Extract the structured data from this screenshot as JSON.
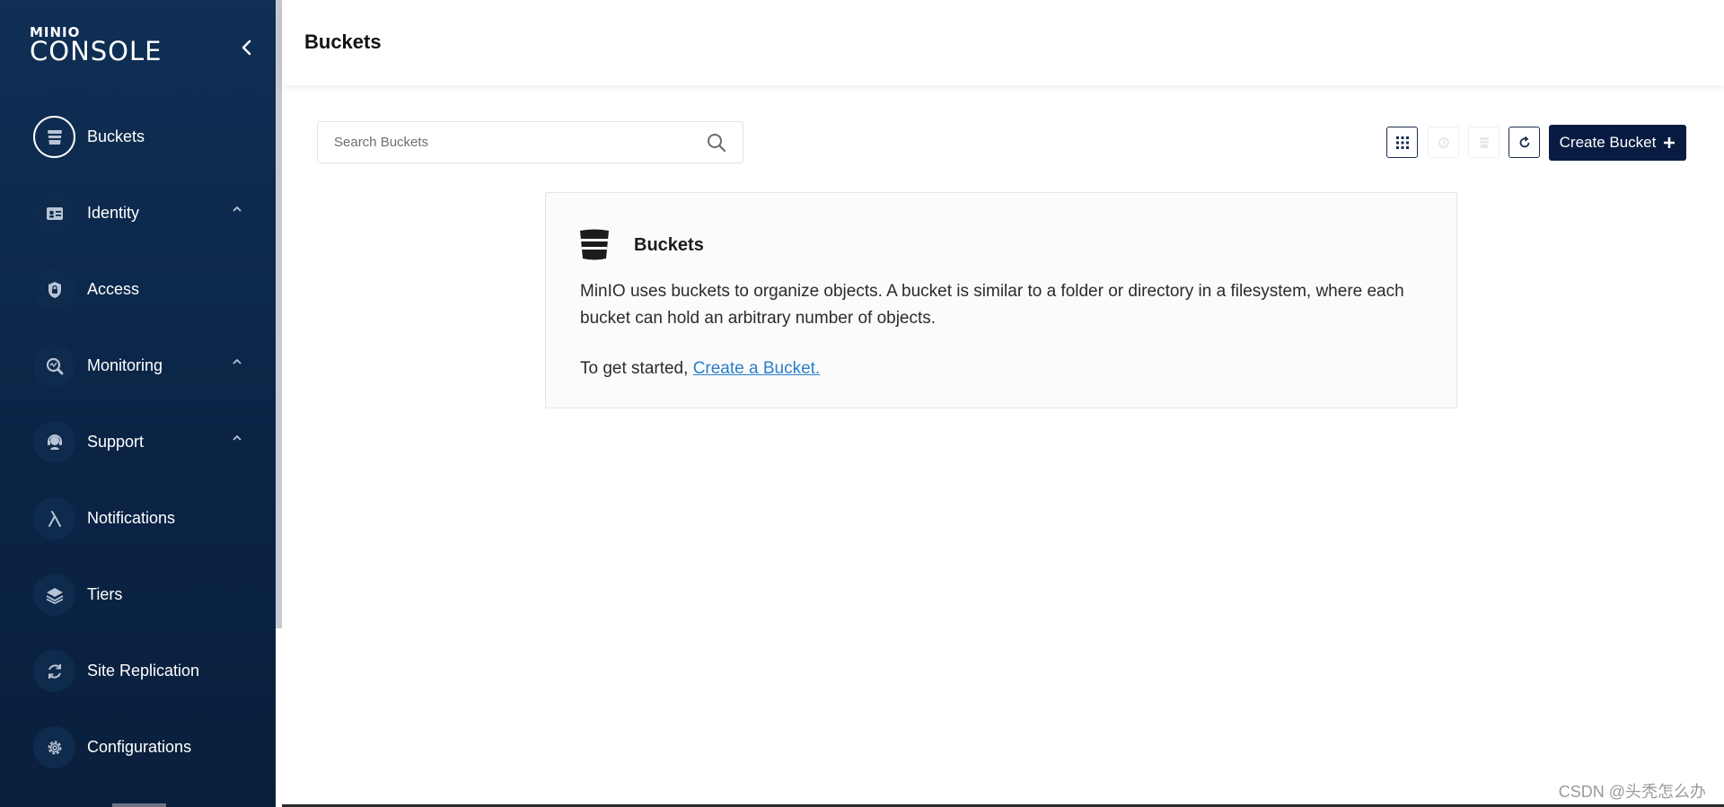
{
  "app": {
    "logo_small": "MINIO",
    "logo_big": "CONSOLE"
  },
  "sidebar": {
    "items": [
      {
        "label": "Buckets",
        "icon": "bucket-icon",
        "active": true,
        "expandable": false
      },
      {
        "label": "Identity",
        "icon": "id-card-icon",
        "active": false,
        "expandable": true
      },
      {
        "label": "Access",
        "icon": "lock-shield-icon",
        "active": false,
        "expandable": false
      },
      {
        "label": "Monitoring",
        "icon": "monitoring-icon",
        "active": false,
        "expandable": true
      },
      {
        "label": "Support",
        "icon": "support-icon",
        "active": false,
        "expandable": true
      },
      {
        "label": "Notifications",
        "icon": "lambda-icon",
        "active": false,
        "expandable": false
      },
      {
        "label": "Tiers",
        "icon": "layers-icon",
        "active": false,
        "expandable": false
      },
      {
        "label": "Site Replication",
        "icon": "replication-icon",
        "active": false,
        "expandable": false
      },
      {
        "label": "Configurations",
        "icon": "gear-icon",
        "active": false,
        "expandable": false
      }
    ]
  },
  "header": {
    "title": "Buckets"
  },
  "search": {
    "placeholder": "Search Buckets",
    "value": ""
  },
  "toolbar": {
    "create_label": "Create Bucket"
  },
  "info_card": {
    "title": "Buckets",
    "description": "MinIO uses buckets to organize objects. A bucket is similar to a folder or directory in a filesystem, where each bucket can hold an arbitrary number of objects.",
    "start_prefix": "To get started,",
    "start_link": "Create a Bucket."
  },
  "watermark": "CSDN @头秃怎么办",
  "colors": {
    "sidebar": "#0b2446",
    "primary_button": "#081c42",
    "link": "#2a7fc9"
  }
}
